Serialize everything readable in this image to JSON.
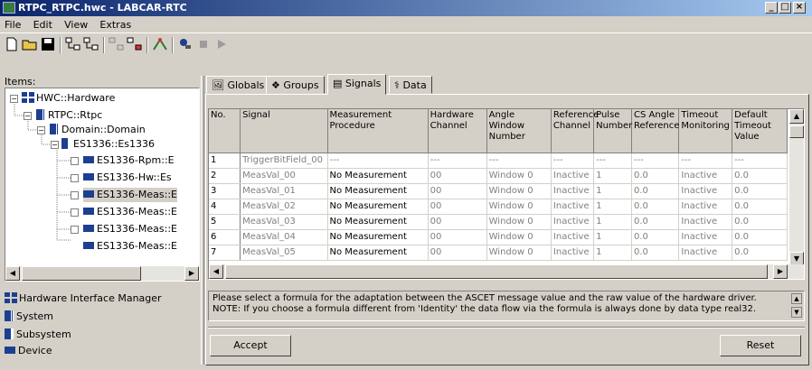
{
  "window": {
    "title": "RTPC_RTPC.hwc - LABCAR-RTC"
  },
  "menu": [
    "File",
    "Edit",
    "View",
    "Extras"
  ],
  "left": {
    "items_label": "Items:",
    "tree": [
      {
        "label": "HWC::Hardware",
        "icon": "hardware-icon",
        "expanded": true
      },
      {
        "label": "RTPC::Rtpc",
        "icon": "system-icon",
        "expanded": true
      },
      {
        "label": "Domain::Domain",
        "icon": "system-icon",
        "expanded": true
      },
      {
        "label": "ES1336::Es1336",
        "icon": "subsystem-icon",
        "expanded": true
      },
      {
        "label": "ES1336-Rpm::E",
        "icon": "device-icon"
      },
      {
        "label": "ES1336-Hw::Es",
        "icon": "device-icon"
      },
      {
        "label": "ES1336-Meas::E",
        "icon": "device-icon",
        "selected": true
      },
      {
        "label": "ES1336-Meas::E",
        "icon": "device-icon"
      },
      {
        "label": "ES1336-Meas::E",
        "icon": "device-icon"
      },
      {
        "label": "ES1336-Meas::E",
        "icon": "device-icon"
      }
    ],
    "legend": [
      {
        "label": "Hardware Interface Manager",
        "icon": "hardware-icon"
      },
      {
        "label": "System",
        "icon": "system-icon"
      },
      {
        "label": "Subsystem",
        "icon": "subsystem-icon"
      },
      {
        "label": "Device",
        "icon": "device-icon"
      }
    ]
  },
  "tabs": [
    {
      "label": "Globals",
      "active": false
    },
    {
      "label": "Groups",
      "active": false
    },
    {
      "label": "Signals",
      "active": true
    },
    {
      "label": "Data",
      "active": false
    }
  ],
  "table": {
    "columns": [
      "No.",
      "Signal",
      "Measurement Procedure",
      "Hardware Channel",
      "Angle Window Number",
      "Reference Channel",
      "Pulse Number",
      "CS Angle Reference",
      "Timeout Monitoring",
      "Default Timeout Value"
    ],
    "rows": [
      [
        "1",
        "TriggerBitField_00",
        "---",
        "---",
        "---",
        "---",
        "---",
        "---",
        "---",
        "---"
      ],
      [
        "2",
        "MeasVal_00",
        "No Measurement",
        "00",
        "Window 0",
        "Inactive",
        "1",
        "0.0",
        "Inactive",
        "0.0"
      ],
      [
        "3",
        "MeasVal_01",
        "No Measurement",
        "00",
        "Window 0",
        "Inactive",
        "1",
        "0.0",
        "Inactive",
        "0.0"
      ],
      [
        "4",
        "MeasVal_02",
        "No Measurement",
        "00",
        "Window 0",
        "Inactive",
        "1",
        "0.0",
        "Inactive",
        "0.0"
      ],
      [
        "5",
        "MeasVal_03",
        "No Measurement",
        "00",
        "Window 0",
        "Inactive",
        "1",
        "0.0",
        "Inactive",
        "0.0"
      ],
      [
        "6",
        "MeasVal_04",
        "No Measurement",
        "00",
        "Window 0",
        "Inactive",
        "1",
        "0.0",
        "Inactive",
        "0.0"
      ],
      [
        "7",
        "MeasVal_05",
        "No Measurement",
        "00",
        "Window 0",
        "Inactive",
        "1",
        "0.0",
        "Inactive",
        "0.0"
      ]
    ]
  },
  "note": {
    "line1": "Please select a formula for the adaptation between the ASCET message value and the raw value of the hardware driver.",
    "line2": "NOTE: If you choose a formula different from 'Identity' the data flow via the formula is always done by data type real32."
  },
  "buttons": {
    "accept": "Accept",
    "reset": "Reset"
  },
  "colors": {
    "title_gradient_start": "#0a246a",
    "title_gradient_end": "#a6caf0",
    "icon_blue": "#1c3f8f"
  }
}
